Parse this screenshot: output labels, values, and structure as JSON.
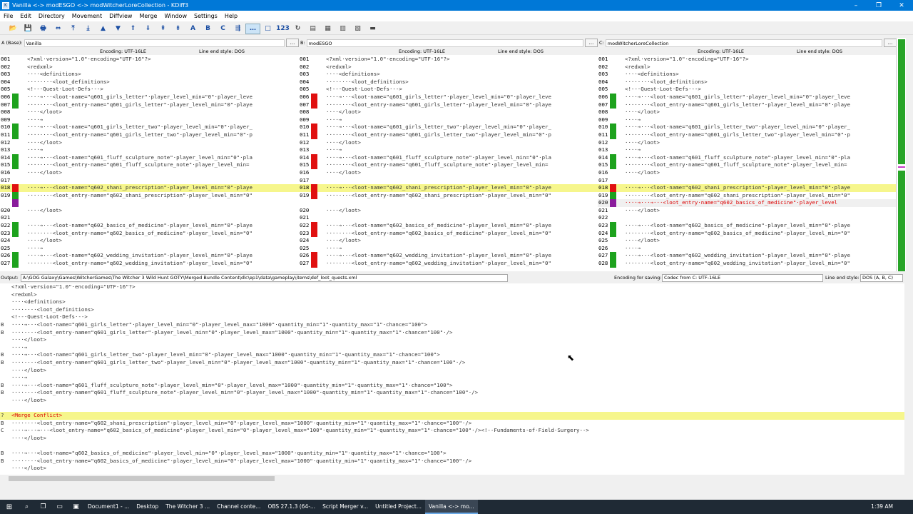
{
  "window": {
    "title": "Vanilla <-> modESGO <-> modWitcherLoreCollection - KDiff3",
    "minimize": "–",
    "maximize": "❐",
    "close": "✕"
  },
  "menu": [
    "File",
    "Edit",
    "Directory",
    "Movement",
    "Diffview",
    "Merge",
    "Window",
    "Settings",
    "Help"
  ],
  "toolbar": [
    {
      "icon": "open-folder-icon",
      "glyph": "📂"
    },
    {
      "icon": "save-icon",
      "glyph": "💾"
    },
    {
      "icon": "print-icon",
      "glyph": "🖶"
    },
    {
      "icon": "go-current-icon",
      "glyph": "⇔"
    },
    {
      "icon": "go-top-icon",
      "glyph": "⤒"
    },
    {
      "icon": "go-bottom-icon",
      "glyph": "⤓"
    },
    {
      "icon": "go-prev-delta-icon",
      "glyph": "▲"
    },
    {
      "icon": "go-next-delta-icon",
      "glyph": "▼"
    },
    {
      "icon": "go-prev-conflict-icon",
      "glyph": "⇑"
    },
    {
      "icon": "go-next-conflict-icon",
      "glyph": "⇓"
    },
    {
      "icon": "go-prev-unsolved-icon",
      "glyph": "⇞"
    },
    {
      "icon": "go-next-unsolved-icon",
      "glyph": "⇟"
    },
    {
      "icon": "select-a-icon",
      "glyph": "A"
    },
    {
      "icon": "select-b-icon",
      "glyph": "B"
    },
    {
      "icon": "select-c-icon",
      "glyph": "C"
    },
    {
      "icon": "auto-advance-icon",
      "glyph": "⇶"
    },
    {
      "icon": "show-whitespace-icon",
      "glyph": "…"
    },
    {
      "icon": "show-space-icon",
      "glyph": "□"
    },
    {
      "icon": "line-numbers-icon",
      "glyph": "123"
    },
    {
      "icon": "word-wrap-icon",
      "glyph": "↻"
    },
    {
      "icon": "split-view-icon",
      "glyph": "▤"
    },
    {
      "icon": "window-a-icon",
      "glyph": "▦"
    },
    {
      "icon": "window-b-icon",
      "glyph": "▥"
    },
    {
      "icon": "window-c-icon",
      "glyph": "▧"
    },
    {
      "icon": "overview-icon",
      "glyph": "▬"
    }
  ],
  "panes": [
    {
      "label": "A (Base):",
      "source": "Vanilla"
    },
    {
      "label": "B:",
      "source": "modESGO"
    },
    {
      "label": "C:",
      "source": "modWitcherLoreCollection"
    }
  ],
  "encoding": "Encoding: UTF-16LE",
  "line_end": "Line end style: DOS",
  "browse": "...",
  "colors": {
    "highlight": "#f6f68c",
    "mark_green": "#1da21d",
    "mark_red": "#e01010",
    "mark_purple": "#8a1c9c",
    "conflict_text": "#d00000"
  },
  "diff_lines": [
    {
      "n": [
        "001",
        "001",
        "001"
      ],
      "m": [
        "",
        "",
        ""
      ],
      "t": [
        "<?xml·version=\"1.0\"·encoding=\"UTF-16\"?>",
        "<?xml·version=\"1.0\"·encoding=\"UTF-16\"?>",
        "<?xml·version=\"1.0\"·encoding=\"UTF-16\"?>"
      ],
      "cls": [
        "",
        "",
        ""
      ]
    },
    {
      "n": [
        "002",
        "002",
        "002"
      ],
      "m": [
        "",
        "",
        ""
      ],
      "t": [
        "<redxml>",
        "<redxml>",
        "<redxml>"
      ],
      "cls": [
        "",
        "",
        ""
      ]
    },
    {
      "n": [
        "003",
        "003",
        "003"
      ],
      "m": [
        "",
        "",
        ""
      ],
      "t": [
        "····<definitions>",
        "····<definitions>",
        "····<definitions>"
      ],
      "cls": [
        "",
        "",
        ""
      ]
    },
    {
      "n": [
        "004",
        "004",
        "004"
      ],
      "m": [
        "",
        "",
        ""
      ],
      "t": [
        "········<loot_definitions>",
        "········<loot_definitions>",
        "········<loot_definitions>"
      ],
      "cls": [
        "",
        "",
        ""
      ]
    },
    {
      "n": [
        "005",
        "005",
        "005"
      ],
      "m": [
        "",
        "",
        ""
      ],
      "t": [
        "<!--·Quest·Loot·Defs·-->",
        "<!--·Quest·Loot·Defs·-->",
        "<!--·Quest·Loot·Defs·-->"
      ],
      "cls": [
        "",
        "",
        ""
      ]
    },
    {
      "n": [
        "006",
        "006",
        "006"
      ],
      "m": [
        "green",
        "red",
        "green"
      ],
      "t": [
        "····→···<loot·name=\"q601_girls_letter\"·player_level_min=\"0\"·player_leve",
        "····→···<loot·name=\"q601_girls_letter\"·player_level_min=\"0\"·player_leve",
        "····→···<loot·name=\"q601_girls_letter\"·player_level_min=\"0\"·player_leve"
      ],
      "cls": [
        "",
        "",
        ""
      ]
    },
    {
      "n": [
        "007",
        "007",
        "007"
      ],
      "m": [
        "green",
        "red",
        "green"
      ],
      "t": [
        "········<loot_entry·name=\"q601_girls_letter\"·player_level_min=\"0\"·playe",
        "········<loot_entry·name=\"q601_girls_letter\"·player_level_min=\"0\"·playe",
        "········<loot_entry·name=\"q601_girls_letter\"·player_level_min=\"0\"·playe"
      ],
      "cls": [
        "",
        "",
        ""
      ]
    },
    {
      "n": [
        "008",
        "008",
        "008"
      ],
      "m": [
        "",
        "",
        ""
      ],
      "t": [
        "····</loot>",
        "····</loot>",
        "····</loot>"
      ],
      "cls": [
        "",
        "",
        ""
      ]
    },
    {
      "n": [
        "009",
        "009",
        "009"
      ],
      "m": [
        "",
        "",
        ""
      ],
      "t": [
        "····→",
        "····→",
        "····→"
      ],
      "cls": [
        "",
        "",
        ""
      ]
    },
    {
      "n": [
        "010",
        "010",
        "010"
      ],
      "m": [
        "green",
        "red",
        "green"
      ],
      "t": [
        "····→···<loot·name=\"q601_girls_letter_two\"·player_level_min=\"0\"·player_",
        "····→···<loot·name=\"q601_girls_letter_two\"·player_level_min=\"0\"·player_",
        "····→···<loot·name=\"q601_girls_letter_two\"·player_level_min=\"0\"·player_"
      ],
      "cls": [
        "",
        "",
        ""
      ]
    },
    {
      "n": [
        "011",
        "011",
        "011"
      ],
      "m": [
        "green",
        "red",
        "green"
      ],
      "t": [
        "········<loot_entry·name=\"q601_girls_letter_two\"·player_level_min=\"0\"·p",
        "········<loot_entry·name=\"q601_girls_letter_two\"·player_level_min=\"0\"·p",
        "········<loot_entry·name=\"q601_girls_letter_two\"·player_level_min=\"0\"·p"
      ],
      "cls": [
        "",
        "",
        ""
      ]
    },
    {
      "n": [
        "012",
        "012",
        "012"
      ],
      "m": [
        "",
        "",
        ""
      ],
      "t": [
        "····</loot>",
        "····</loot>",
        "····</loot>"
      ],
      "cls": [
        "",
        "",
        ""
      ]
    },
    {
      "n": [
        "013",
        "013",
        "013"
      ],
      "m": [
        "",
        "",
        ""
      ],
      "t": [
        "····→",
        "····→",
        "····→"
      ],
      "cls": [
        "",
        "",
        ""
      ]
    },
    {
      "n": [
        "014",
        "014",
        "014"
      ],
      "m": [
        "green",
        "red",
        "green"
      ],
      "t": [
        "····→···<loot·name=\"q601_fluff_sculpture_note\"·player_level_min=\"0\"·pla",
        "····→···<loot·name=\"q601_fluff_sculpture_note\"·player_level_min=\"0\"·pla",
        "····→···<loot·name=\"q601_fluff_sculpture_note\"·player_level_min=\"0\"·pla"
      ],
      "cls": [
        "",
        "",
        ""
      ]
    },
    {
      "n": [
        "015",
        "015",
        "015"
      ],
      "m": [
        "green",
        "red",
        "green"
      ],
      "t": [
        "········<loot_entry·name=\"q601_fluff_sculpture_note\"·player_level_min=",
        "········<loot_entry·name=\"q601_fluff_sculpture_note\"·player_level_min=",
        "········<loot_entry·name=\"q601_fluff_sculpture_note\"·player_level_min="
      ],
      "cls": [
        "",
        "",
        ""
      ]
    },
    {
      "n": [
        "016",
        "016",
        "016"
      ],
      "m": [
        "",
        "",
        ""
      ],
      "t": [
        "····</loot>",
        "····</loot>",
        "····</loot>"
      ],
      "cls": [
        "",
        "",
        ""
      ]
    },
    {
      "n": [
        "017",
        "017",
        "017"
      ],
      "m": [
        "",
        "",
        ""
      ],
      "t": [
        "",
        "",
        ""
      ],
      "cls": [
        "",
        "",
        ""
      ]
    },
    {
      "n": [
        "018",
        "018",
        "018"
      ],
      "m": [
        "red",
        "red",
        "red"
      ],
      "t": [
        "····→···<loot·name=\"q602_shani_prescription\"·player_level_min=\"0\"·playe",
        "····→···<loot·name=\"q602_shani_prescription\"·player_level_min=\"0\"·playe",
        "····→···<loot·name=\"q602_shani_prescription\"·player_level_min=\"0\"·playe"
      ],
      "cls": [
        "hl",
        "hl",
        "hl"
      ]
    },
    {
      "n": [
        "019",
        "019",
        "019"
      ],
      "m": [
        "green",
        "red",
        "green"
      ],
      "t": [
        "········<loot_entry·name=\"q602_shani_prescription\"·player_level_min=\"0\"",
        "········<loot_entry·name=\"q602_shani_prescription\"·player_level_min=\"0\"",
        "········<loot_entry·name=\"q602_shani_prescription\"·player_level_min=\"0\""
      ],
      "cls": [
        "",
        "",
        ""
      ]
    },
    {
      "n": [
        "",
        "",
        "020"
      ],
      "m": [
        "purple",
        "",
        "purple"
      ],
      "t": [
        "",
        "",
        "····→···→···<loot_entry·name=\"q602_basics_of_medicine\"·player_level"
      ],
      "cls": [
        "",
        "",
        "rd"
      ]
    },
    {
      "n": [
        "",
        "020",
        "021"
      ],
      "m": [
        "",
        "",
        ""
      ],
      "t": [
        "····</loot>",
        "····</loot>",
        "····</loot>"
      ],
      "cls": [
        "",
        "",
        ""
      ]
    },
    {
      "n": [
        "",
        "021",
        "022"
      ],
      "m": [
        "",
        "",
        ""
      ],
      "t": [
        "",
        "",
        ""
      ],
      "cls": [
        "",
        "",
        ""
      ]
    },
    {
      "n": [
        "",
        "022",
        "023"
      ],
      "m": [
        "green",
        "red",
        "green"
      ],
      "t": [
        "····→···<loot·name=\"q602_basics_of_medicine\"·player_level_min=\"0\"·playe",
        "····→···<loot·name=\"q602_basics_of_medicine\"·player_level_min=\"0\"·playe",
        "····→···<loot·name=\"q602_basics_of_medicine\"·player_level_min=\"0\"·playe"
      ],
      "cls": [
        "",
        "",
        ""
      ]
    },
    {
      "n": [
        "",
        "023",
        "024"
      ],
      "m": [
        "green",
        "red",
        "green"
      ],
      "t": [
        "········<loot_entry·name=\"q602_basics_of_medicine\"·player_level_min=\"0\"",
        "········<loot_entry·name=\"q602_basics_of_medicine\"·player_level_min=\"0\"",
        "········<loot_entry·name=\"q602_basics_of_medicine\"·player_level_min=\"0\""
      ],
      "cls": [
        "",
        "",
        ""
      ]
    },
    {
      "n": [
        "",
        "024",
        "025"
      ],
      "m": [
        "",
        "",
        ""
      ],
      "t": [
        "····</loot>",
        "····</loot>",
        "····</loot>"
      ],
      "cls": [
        "",
        "",
        ""
      ]
    },
    {
      "n": [
        "",
        "025",
        "026"
      ],
      "m": [
        "",
        "",
        ""
      ],
      "t": [
        "····→",
        "····→",
        "····→"
      ],
      "cls": [
        "",
        "",
        ""
      ]
    },
    {
      "n": [
        "",
        "026",
        "027"
      ],
      "m": [
        "green",
        "red",
        "green"
      ],
      "t": [
        "····→···<loot·name=\"q602_wedding_invitation\"·player_level_min=\"0\"·playe",
        "····→···<loot·name=\"q602_wedding_invitation\"·player_level_min=\"0\"·playe",
        "····→···<loot·name=\"q602_wedding_invitation\"·player_level_min=\"0\"·playe"
      ],
      "cls": [
        "",
        "",
        ""
      ]
    },
    {
      "n": [
        "",
        "027",
        "028"
      ],
      "m": [
        "green",
        "red",
        "green"
      ],
      "t": [
        "········<loot_entry·name=\"q602_wedding_invitation\"·player_level_min=\"0\"",
        "········<loot_entry·name=\"q602_wedding_invitation\"·player_level_min=\"0\"",
        "········<loot_entry·name=\"q602_wedding_invitation\"·player_level_min=\"0\""
      ],
      "cls": [
        "",
        "",
        ""
      ]
    }
  ],
  "left_num_override": [
    "001",
    "002",
    "003",
    "004",
    "005",
    "006",
    "007",
    "008",
    "009",
    "010",
    "011",
    "012",
    "013",
    "014",
    "015",
    "016",
    "017",
    "018",
    "019",
    "",
    "020",
    "021",
    "022",
    "023",
    "024",
    "025",
    "026",
    "027"
  ],
  "output": {
    "label": "Output:",
    "path": "A:\\GOG Galaxy\\Games\\WitcherGames\\The Witcher 3 Wild Hunt GOTY\\Merged Bundle Content\\dlc\\ep1\\data\\gameplay\\items\\def_loot_quests.xml",
    "enc_label": "Encoding for saving:",
    "codec": "Codec from C: UTF-16LE",
    "eol_label": "Line end style:",
    "eol_value": "DOS (A, B, C)",
    "lines": [
      {
        "s": "",
        "t": "<?xml·version=\"1.0\"·encoding=\"UTF-16\"?>"
      },
      {
        "s": "",
        "t": "<redxml>"
      },
      {
        "s": "",
        "t": "····<definitions>"
      },
      {
        "s": "",
        "t": "········<loot_definitions>"
      },
      {
        "s": "",
        "t": "<!--·Quest·Loot·Defs·-->"
      },
      {
        "s": "B",
        "t": "····→···<loot·name=\"q601_girls_letter\"·player_level_min=\"0\"·player_level_max=\"1000\"·quantity_min=\"1\"·quantity_max=\"1\"·chance=\"100\">"
      },
      {
        "s": "B",
        "t": "········<loot_entry·name=\"q601_girls_letter\"·player_level_min=\"0\"·player_level_max=\"1000\"·quantity_min=\"1\"·quantity_max=\"1\"·chance=\"100\"·/>"
      },
      {
        "s": "",
        "t": "····</loot>"
      },
      {
        "s": "",
        "t": "····→"
      },
      {
        "s": "B",
        "t": "····→···<loot·name=\"q601_girls_letter_two\"·player_level_min=\"0\"·player_level_max=\"1000\"·quantity_min=\"1\"·quantity_max=\"1\"·chance=\"100\">"
      },
      {
        "s": "B",
        "t": "········<loot_entry·name=\"q601_girls_letter_two\"·player_level_min=\"0\"·player_level_max=\"1000\"·quantity_min=\"1\"·quantity_max=\"1\"·chance=\"100\"·/>"
      },
      {
        "s": "",
        "t": "····</loot>"
      },
      {
        "s": "",
        "t": "····→"
      },
      {
        "s": "B",
        "t": "····→···<loot·name=\"q601_fluff_sculpture_note\"·player_level_min=\"0\"·player_level_max=\"1000\"·quantity_min=\"1\"·quantity_max=\"1\"·chance=\"100\">"
      },
      {
        "s": "B",
        "t": "········<loot_entry·name=\"q601_fluff_sculpture_note\"·player_level_min=\"0\"·player_level_max=\"1000\"·quantity_min=\"1\"·quantity_max=\"1\"·chance=\"100\"·/>"
      },
      {
        "s": "",
        "t": "····</loot>"
      },
      {
        "s": "",
        "t": ""
      },
      {
        "s": "?",
        "t": "<Merge Conflict>",
        "c": "conf"
      },
      {
        "s": "B",
        "t": "········<loot_entry·name=\"q602_shani_prescription\"·player_level_min=\"0\"·player_level_max=\"1000\"·quantity_min=\"1\"·quantity_max=\"1\"·chance=\"100\"·/>"
      },
      {
        "s": "C",
        "t": "····→···→···<loot_entry·name=\"q602_basics_of_medicine\"·player_level_min=\"0\"·player_level_max=\"100\"·quantity_min=\"1\"·quantity_max=\"1\"·chance=\"100\"·/><!--Fundaments·of·Field·Surgery-->"
      },
      {
        "s": "",
        "t": "····</loot>"
      },
      {
        "s": "",
        "t": ""
      },
      {
        "s": "B",
        "t": "····→···<loot·name=\"q602_basics_of_medicine\"·player_level_min=\"0\"·player_level_max=\"1000\"·quantity_min=\"1\"·quantity_max=\"1\"·chance=\"100\">"
      },
      {
        "s": "B",
        "t": "········<loot_entry·name=\"q602_basics_of_medicine\"·player_level_min=\"0\"·player_level_max=\"1000\"·quantity_min=\"1\"·quantity_max=\"1\"·chance=\"100\"·/>"
      },
      {
        "s": "",
        "t": "····</loot>"
      }
    ]
  },
  "taskbar": {
    "icons": [
      "search-icon",
      "task-view-icon",
      "file-explorer-icon",
      "store-icon"
    ],
    "items": [
      {
        "label": "Document1 - ...",
        "active": false
      },
      {
        "label": "Desktop",
        "active": false
      },
      {
        "label": "The Witcher 3 ...",
        "active": false
      },
      {
        "label": "Channel conte...",
        "active": false
      },
      {
        "label": "OBS 27.1.3 (64-...",
        "active": false
      },
      {
        "label": "Script Merger v...",
        "active": false
      },
      {
        "label": "Untitled Project...",
        "active": false
      },
      {
        "label": "Vanilla <-> mo...",
        "active": true
      }
    ],
    "clock": "1:39 AM"
  }
}
